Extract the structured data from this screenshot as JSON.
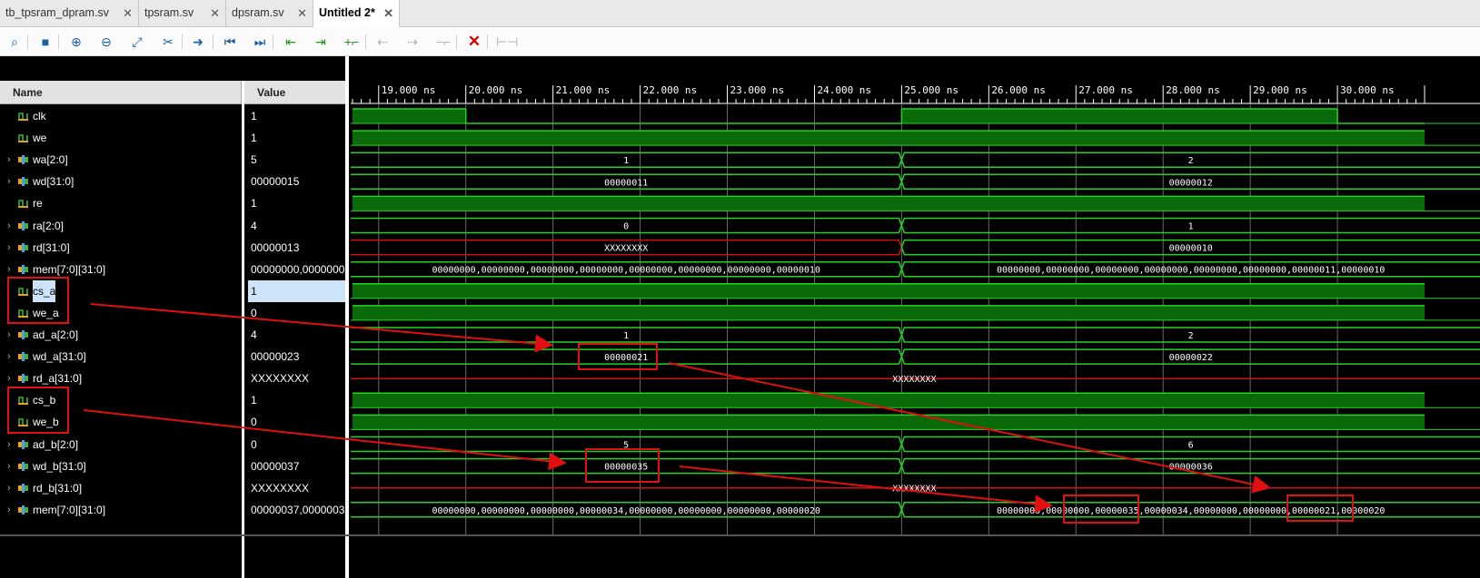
{
  "tabs": [
    {
      "label": "tb_tpsram_dpram.sv",
      "active": false
    },
    {
      "label": "tpsram.sv",
      "active": false
    },
    {
      "label": "dpsram.sv",
      "active": false
    },
    {
      "label": "Untitled 2*",
      "active": true
    }
  ],
  "toolbar": [
    {
      "name": "search",
      "glyph": "⌕",
      "state": "normal"
    },
    {
      "name": "save",
      "glyph": "■",
      "state": "normal"
    },
    {
      "name": "zoom-in",
      "glyph": "⊕",
      "state": "normal"
    },
    {
      "name": "zoom-out",
      "glyph": "⊖",
      "state": "normal"
    },
    {
      "name": "zoom-fit",
      "glyph": "⤢",
      "state": "normal"
    },
    {
      "name": "snap",
      "glyph": "✂",
      "state": "normal"
    },
    {
      "name": "go-to-cursor",
      "glyph": "➜",
      "state": "normal"
    },
    {
      "name": "go-to-start",
      "glyph": "⏮",
      "state": "normal"
    },
    {
      "name": "go-to-end",
      "glyph": "⏭",
      "state": "normal"
    },
    {
      "name": "previous-transition",
      "glyph": "⇤",
      "state": "green"
    },
    {
      "name": "next-transition",
      "glyph": "⇥",
      "state": "green"
    },
    {
      "name": "add-marker",
      "glyph": "+⌐",
      "state": "green"
    },
    {
      "name": "previous-marker",
      "glyph": "⇠",
      "state": "disabled"
    },
    {
      "name": "next-marker",
      "glyph": "⇢",
      "state": "disabled"
    },
    {
      "name": "delete-marker",
      "glyph": "−⌐",
      "state": "disabled"
    },
    {
      "name": "delete-all-markers",
      "glyph": "✕",
      "state": "red"
    },
    {
      "name": "swap-cursors",
      "glyph": "⊢⊣",
      "state": "disabled"
    }
  ],
  "headers": {
    "name": "Name",
    "value": "Value"
  },
  "time_axis": {
    "labels": [
      "19.000 ns",
      "20.000 ns",
      "21.000 ns",
      "22.000 ns",
      "23.000 ns",
      "24.000 ns",
      "25.000 ns",
      "26.000 ns",
      "27.000 ns",
      "28.000 ns",
      "29.000 ns",
      "30.000 ns"
    ],
    "start_ns": 18.7,
    "end_ns": 31.0,
    "transition_ns": 25.0
  },
  "signals": [
    {
      "name": "clk",
      "value": "1",
      "kind": "bit",
      "expandable": false,
      "wave": {
        "type": "clk",
        "segments": [
          {
            "from": 18.7,
            "to": 20.0,
            "level": 1
          },
          {
            "from": 20.0,
            "to": 25.0,
            "level": 0
          },
          {
            "from": 25.0,
            "to": 30.0,
            "level": 1
          },
          {
            "from": 30.0,
            "to": 31.0,
            "level": 0
          }
        ]
      }
    },
    {
      "name": "we",
      "value": "1",
      "kind": "bit",
      "expandable": false,
      "wave": {
        "type": "high"
      }
    },
    {
      "name": "wa[2:0]",
      "value": "5",
      "kind": "bus",
      "expandable": true,
      "wave": {
        "type": "bus",
        "before": "1",
        "after": "2"
      }
    },
    {
      "name": "wd[31:0]",
      "value": "00000015",
      "kind": "bus",
      "expandable": true,
      "wave": {
        "type": "bus",
        "before": "00000011",
        "after": "00000012"
      }
    },
    {
      "name": "re",
      "value": "1",
      "kind": "bit",
      "expandable": false,
      "wave": {
        "type": "high"
      }
    },
    {
      "name": "ra[2:0]",
      "value": "4",
      "kind": "bus",
      "expandable": true,
      "wave": {
        "type": "bus",
        "before": "0",
        "after": "1"
      }
    },
    {
      "name": "rd[31:0]",
      "value": "00000013",
      "kind": "bus",
      "expandable": true,
      "wave": {
        "type": "bus",
        "before": "XXXXXXXX",
        "before_red": true,
        "after": "00000010"
      }
    },
    {
      "name": "mem[7:0][31:0]",
      "value": "00000000,0000000",
      "kind": "bus",
      "expandable": true,
      "wave": {
        "type": "bus",
        "before": "00000000,00000000,00000000,00000000,00000000,00000000,00000000,00000010",
        "after": "00000000,00000000,00000000,00000000,00000000,00000000,00000011,00000010"
      }
    },
    {
      "name": "cs_a",
      "value": "1",
      "kind": "bit",
      "expandable": false,
      "selected": true,
      "wave": {
        "type": "high"
      }
    },
    {
      "name": "we_a",
      "value": "0",
      "kind": "bit",
      "expandable": false,
      "wave": {
        "type": "high"
      }
    },
    {
      "name": "ad_a[2:0]",
      "value": "4",
      "kind": "bus",
      "expandable": true,
      "wave": {
        "type": "bus",
        "before": "1",
        "after": "2"
      }
    },
    {
      "name": "wd_a[31:0]",
      "value": "00000023",
      "kind": "bus",
      "expandable": true,
      "wave": {
        "type": "bus",
        "before": "00000021",
        "after": "00000022"
      }
    },
    {
      "name": "rd_a[31:0]",
      "value": "XXXXXXXX",
      "kind": "bus",
      "expandable": true,
      "wave": {
        "type": "xbus",
        "label": "XXXXXXXX"
      }
    },
    {
      "name": "cs_b",
      "value": "1",
      "kind": "bit",
      "expandable": false,
      "wave": {
        "type": "high"
      }
    },
    {
      "name": "we_b",
      "value": "0",
      "kind": "bit",
      "expandable": false,
      "wave": {
        "type": "high"
      }
    },
    {
      "name": "ad_b[2:0]",
      "value": "0",
      "kind": "bus",
      "expandable": true,
      "wave": {
        "type": "bus",
        "before": "5",
        "after": "6"
      }
    },
    {
      "name": "wd_b[31:0]",
      "value": "00000037",
      "kind": "bus",
      "expandable": true,
      "wave": {
        "type": "bus",
        "before": "00000035",
        "after": "00000036"
      }
    },
    {
      "name": "rd_b[31:0]",
      "value": "XXXXXXXX",
      "kind": "bus",
      "expandable": true,
      "wave": {
        "type": "xbus",
        "label": "XXXXXXXX"
      }
    },
    {
      "name": "mem[7:0][31:0]",
      "value": "00000037,0000003",
      "kind": "bus",
      "expandable": true,
      "wave": {
        "type": "bus",
        "before": "00000000,00000000,00000000,00000034,00000000,00000000,00000000,00000020",
        "after": "00000000,00000000,00000035,00000034,00000000,00000000,00000021,00000020"
      }
    }
  ],
  "colors": {
    "wave_green": "#22d422",
    "wave_fill": "#0a6a0a",
    "x_red": "#d01010",
    "annotation_red": "#e01010",
    "bus_text": "#ffffff"
  }
}
